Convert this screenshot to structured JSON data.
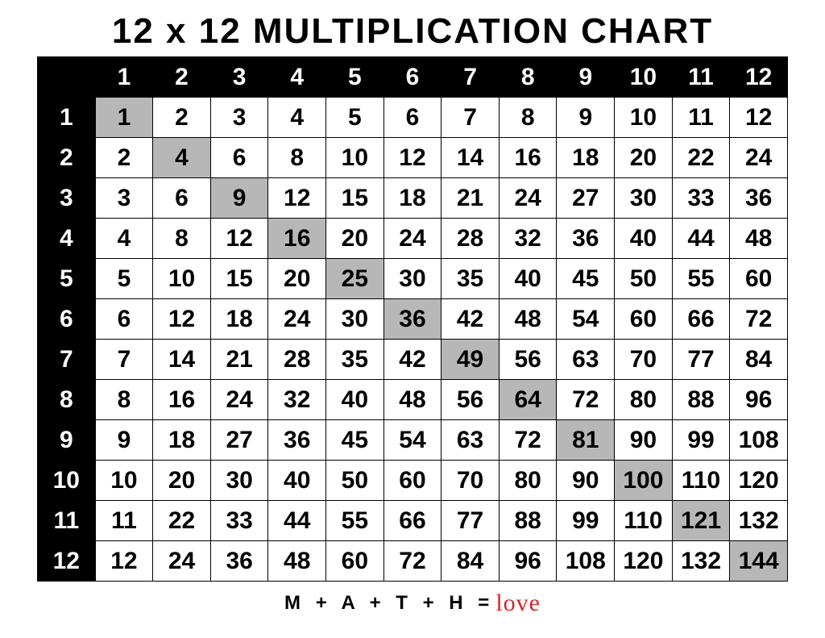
{
  "title": "12 x 12 MULTIPLICATION CHART",
  "size": 12,
  "col_labels": [
    "1",
    "2",
    "3",
    "4",
    "5",
    "6",
    "7",
    "8",
    "9",
    "10",
    "11",
    "12"
  ],
  "row_labels": [
    "1",
    "2",
    "3",
    "4",
    "5",
    "6",
    "7",
    "8",
    "9",
    "10",
    "11",
    "12"
  ],
  "chart_data": {
    "type": "table",
    "title": "12 x 12 Multiplication Chart",
    "columns": [
      1,
      2,
      3,
      4,
      5,
      6,
      7,
      8,
      9,
      10,
      11,
      12
    ],
    "rows": [
      1,
      2,
      3,
      4,
      5,
      6,
      7,
      8,
      9,
      10,
      11,
      12
    ],
    "values": [
      [
        1,
        2,
        3,
        4,
        5,
        6,
        7,
        8,
        9,
        10,
        11,
        12
      ],
      [
        2,
        4,
        6,
        8,
        10,
        12,
        14,
        16,
        18,
        20,
        22,
        24
      ],
      [
        3,
        6,
        9,
        12,
        15,
        18,
        21,
        24,
        27,
        30,
        33,
        36
      ],
      [
        4,
        8,
        12,
        16,
        20,
        24,
        28,
        32,
        36,
        40,
        44,
        48
      ],
      [
        5,
        10,
        15,
        20,
        25,
        30,
        35,
        40,
        45,
        50,
        55,
        60
      ],
      [
        6,
        12,
        18,
        24,
        30,
        36,
        42,
        48,
        54,
        60,
        66,
        72
      ],
      [
        7,
        14,
        21,
        28,
        35,
        42,
        49,
        56,
        63,
        70,
        77,
        84
      ],
      [
        8,
        16,
        24,
        32,
        40,
        48,
        56,
        64,
        72,
        80,
        88,
        96
      ],
      [
        9,
        18,
        27,
        36,
        45,
        54,
        63,
        72,
        81,
        90,
        99,
        108
      ],
      [
        10,
        20,
        30,
        40,
        50,
        60,
        70,
        80,
        90,
        100,
        110,
        120
      ],
      [
        11,
        22,
        33,
        44,
        55,
        66,
        77,
        88,
        99,
        110,
        121,
        132
      ],
      [
        12,
        24,
        36,
        48,
        60,
        72,
        84,
        96,
        108,
        120,
        132,
        144
      ]
    ],
    "diagonal_highlight": true
  },
  "footer": {
    "math_text": "M + A + T + H =",
    "love_text": "love"
  }
}
